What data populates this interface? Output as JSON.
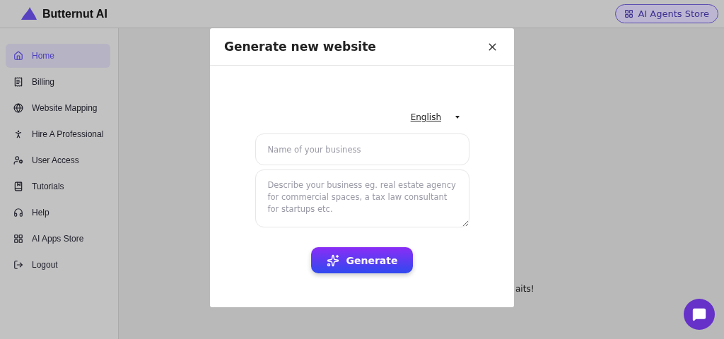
{
  "brand": {
    "name": "Butternut AI"
  },
  "header": {
    "store_button": "AI Agents Store"
  },
  "sidebar": {
    "items": [
      {
        "kind": "home",
        "label": "Home",
        "selected": true
      },
      {
        "kind": "billing",
        "label": "Billing",
        "selected": false
      },
      {
        "kind": "globe",
        "label": "Website Mapping",
        "selected": false
      },
      {
        "kind": "person",
        "label": "Hire A Professional",
        "selected": false
      },
      {
        "kind": "user",
        "label": "User Access",
        "selected": false
      },
      {
        "kind": "tutorials",
        "label": "Tutorials",
        "selected": false
      },
      {
        "kind": "help",
        "label": "Help",
        "selected": false
      },
      {
        "kind": "apps",
        "label": "AI Apps Store",
        "selected": false
      },
      {
        "kind": "logout",
        "label": "Logout",
        "selected": false
      }
    ]
  },
  "background": {
    "text_fragment": "aits!"
  },
  "dialog": {
    "title": "Generate new website",
    "language": "English",
    "name_field": {
      "placeholder": "Name of your business"
    },
    "description_field": {
      "placeholder": "Describe your business eg. real estate agency for commercial spaces, a tax law consultant for startups etc."
    },
    "generate_button": "Generate"
  }
}
